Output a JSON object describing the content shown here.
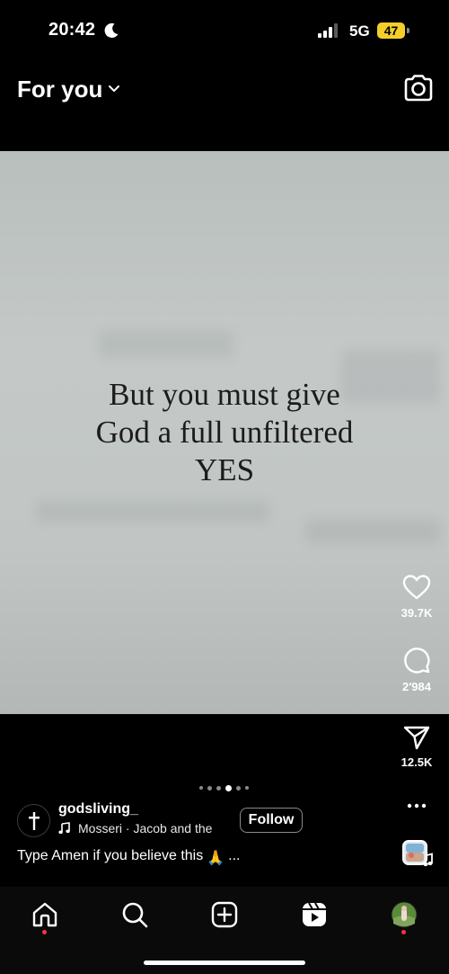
{
  "status_bar": {
    "time": "20:42",
    "network": "5G",
    "battery": "47"
  },
  "header": {
    "title": "For you"
  },
  "post": {
    "image_text": [
      "But you must give",
      "God a full unfiltered",
      "YES"
    ],
    "username": "godsliving_",
    "audio": "Mosseri · Jacob and the",
    "follow_label": "Follow",
    "caption": "Type Amen if you believe this",
    "caption_emoji": "🙏",
    "caption_more": "...",
    "carousel": {
      "count": 6,
      "active_index": 3
    }
  },
  "actions": {
    "likes": "39.7K",
    "comments": "2'984",
    "shares": "12.5K"
  },
  "icons": {
    "header": [
      "chevron-down-icon",
      "camera-icon"
    ],
    "actions": [
      "heart-icon",
      "comment-icon",
      "share-icon",
      "more-icon"
    ],
    "nav": [
      "home-icon",
      "search-icon",
      "create-icon",
      "reels-icon",
      "profile-avatar"
    ]
  },
  "colors": {
    "notification_dot": "#ff3040",
    "battery": "#f4cf2a"
  }
}
